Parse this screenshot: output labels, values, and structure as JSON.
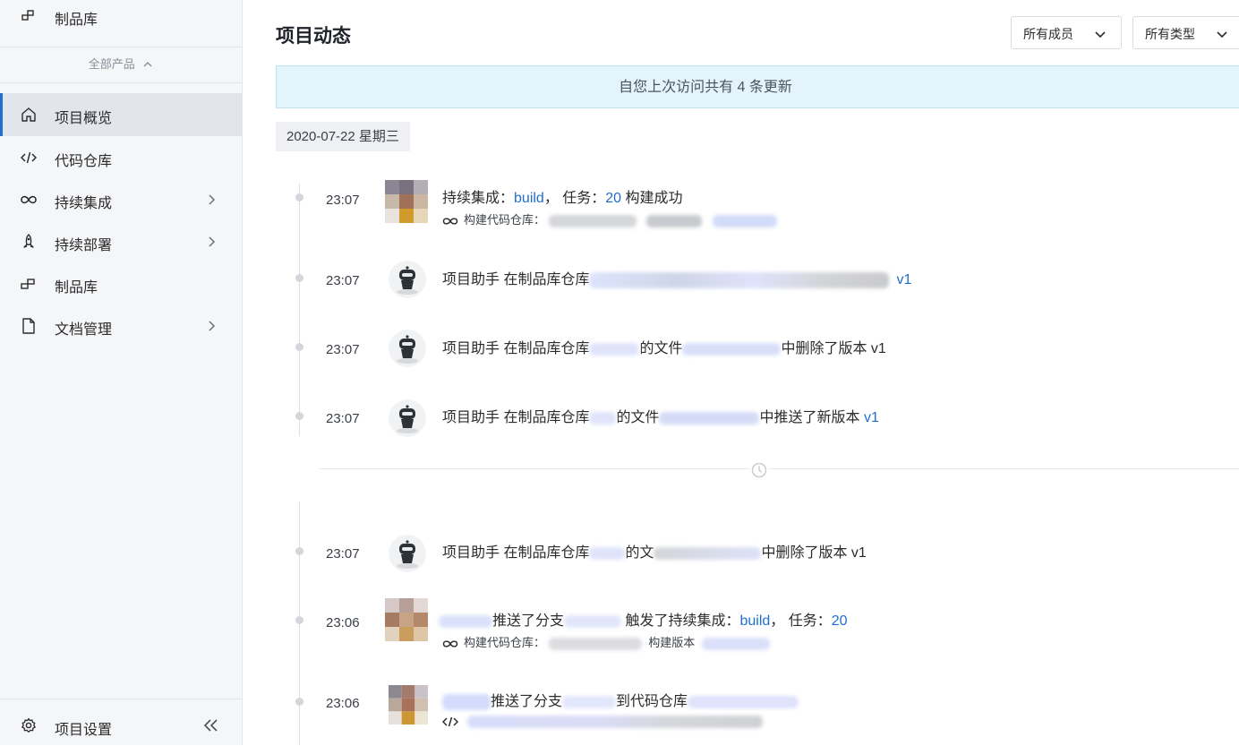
{
  "sidebar": {
    "top_item": {
      "label": "制品库",
      "icon": "artifact-icon"
    },
    "all_products": "全部产品",
    "items": [
      {
        "label": "项目概览",
        "icon": "home-icon",
        "active": true
      },
      {
        "label": "代码仓库",
        "icon": "code-icon"
      },
      {
        "label": "持续集成",
        "icon": "infinity-icon"
      },
      {
        "label": "持续部署",
        "icon": "rocket-icon"
      },
      {
        "label": "制品库",
        "icon": "artifact-icon"
      },
      {
        "label": "文档管理",
        "icon": "document-icon"
      }
    ],
    "settings": "项目设置"
  },
  "header": {
    "title": "项目动态",
    "member_filter": "所有成员",
    "type_filter": "所有类型"
  },
  "banner": "自您上次访问共有 4 条更新",
  "date_tag": "2020-07-22 星期三",
  "events": [
    {
      "time": "23:07",
      "prefix": "持续集成：",
      "link1": "build",
      "mid": "， 任务：",
      "link2": "20",
      "suffix": " 构建成功",
      "sub_label": "构建代码仓库："
    },
    {
      "time": "23:07",
      "actor": "项目助手",
      "text": " 在制品库仓库",
      "tail": "",
      "version": "v1"
    },
    {
      "time": "23:07",
      "actor": "项目助手",
      "text": " 在制品库仓库",
      "mid": "的文件",
      "tail": "中删除了版本 v1"
    },
    {
      "time": "23:07",
      "actor": "项目助手",
      "text": " 在制品库仓库",
      "mid": "的文件",
      "tail": "中推送了新版本 ",
      "version": "v1"
    },
    {
      "time": "23:07",
      "actor": "项目助手",
      "text": " 在制品库仓库",
      "mid": "的文",
      "tail": "中删除了版本 v1"
    },
    {
      "time": "23:06",
      "text": "推送了分支",
      "mid": " 触发了持续集成：",
      "link1": "build",
      "sep": "， 任务：",
      "link2": "20",
      "sub_label": "构建代码仓库：",
      "sub_label2": "构建版本"
    },
    {
      "time": "23:06",
      "text": "推送了分支",
      "mid": "到代码仓库"
    }
  ],
  "colors": {
    "accent": "#1f6fd1",
    "banner_bg": "#e4f4fb",
    "sidebar_bg": "#f5f6f8"
  }
}
